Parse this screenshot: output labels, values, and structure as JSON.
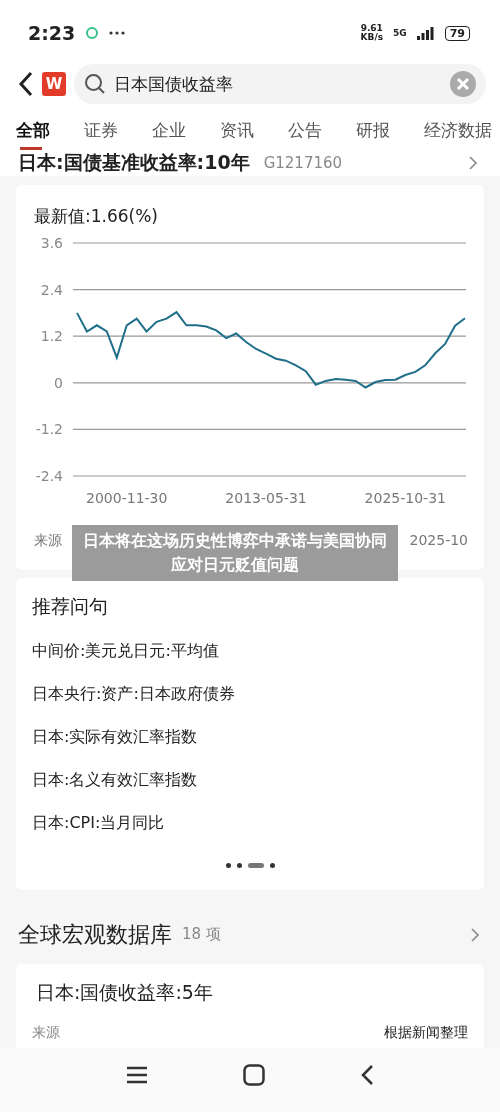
{
  "status_bar": {
    "time": "2:23",
    "speed": "9.61\nKB/s",
    "network": "5G",
    "battery": "79"
  },
  "search": {
    "logo": "W",
    "value": "日本国债收益率"
  },
  "tabs": [
    {
      "label": "全部",
      "selected": true
    },
    {
      "label": "证券",
      "selected": false
    },
    {
      "label": "企业",
      "selected": false
    },
    {
      "label": "资讯",
      "selected": false
    },
    {
      "label": "公告",
      "selected": false
    },
    {
      "label": "研报",
      "selected": false
    },
    {
      "label": "经济数据",
      "selected": false
    }
  ],
  "indicator": {
    "title": "日本:国债基准收益率:10年",
    "code": "G1217160",
    "latest": "最新值:1.66(%)",
    "chart_data": {
      "type": "line",
      "categories": [
        null,
        null,
        null,
        null,
        null,
        "2000-11-30",
        null,
        null,
        null,
        null,
        null,
        null,
        null,
        null,
        null,
        null,
        null,
        null,
        null,
        "2013-05-31",
        null,
        null,
        null,
        null,
        null,
        null,
        null,
        null,
        null,
        null,
        null,
        null,
        null,
        "2025-10-31",
        null,
        null,
        null,
        null,
        null,
        null
      ],
      "series": [
        {
          "color": "#1f6f8b",
          "values": [
            1.8,
            1.32,
            1.48,
            1.32,
            0.65,
            1.48,
            1.65,
            1.32,
            1.57,
            1.65,
            1.82,
            1.48,
            1.48,
            1.45,
            1.35,
            1.15,
            1.27,
            1.05,
            0.87,
            0.75,
            0.62,
            0.57,
            0.45,
            0.3,
            -0.05,
            0.05,
            0.1,
            0.08,
            0.05,
            -0.12,
            0.02,
            0.07,
            0.08,
            0.2,
            0.28,
            0.45,
            0.76,
            1.0,
            1.47,
            1.66
          ]
        }
      ],
      "grid": true,
      "ylim": [
        -2.4,
        3.6
      ],
      "yticks": [
        3.6,
        2.4,
        1.2,
        0,
        -1.2,
        -2.4
      ]
    },
    "source_left": "来源",
    "source_right": "2025-10"
  },
  "headline": "日本将在这场历史性博弈中承诺与美国协同应对日元贬值问题",
  "suggestions": {
    "title": "推荐问句",
    "items": [
      "中间价:美元兑日元:平均值",
      "日本央行:资产:日本政府债券",
      "日本:实际有效汇率指数",
      "日本:名义有效汇率指数",
      "日本:CPI:当月同比"
    ],
    "pager": [
      {
        "selected": false
      },
      {
        "selected": false
      },
      {
        "selected": true
      },
      {
        "selected": false
      }
    ]
  },
  "database": {
    "title": "全球宏观数据库",
    "count": "18 项",
    "item_title": "日本:国债收益率:5年",
    "source_label": "来源",
    "source_value": "根据新闻整理"
  }
}
